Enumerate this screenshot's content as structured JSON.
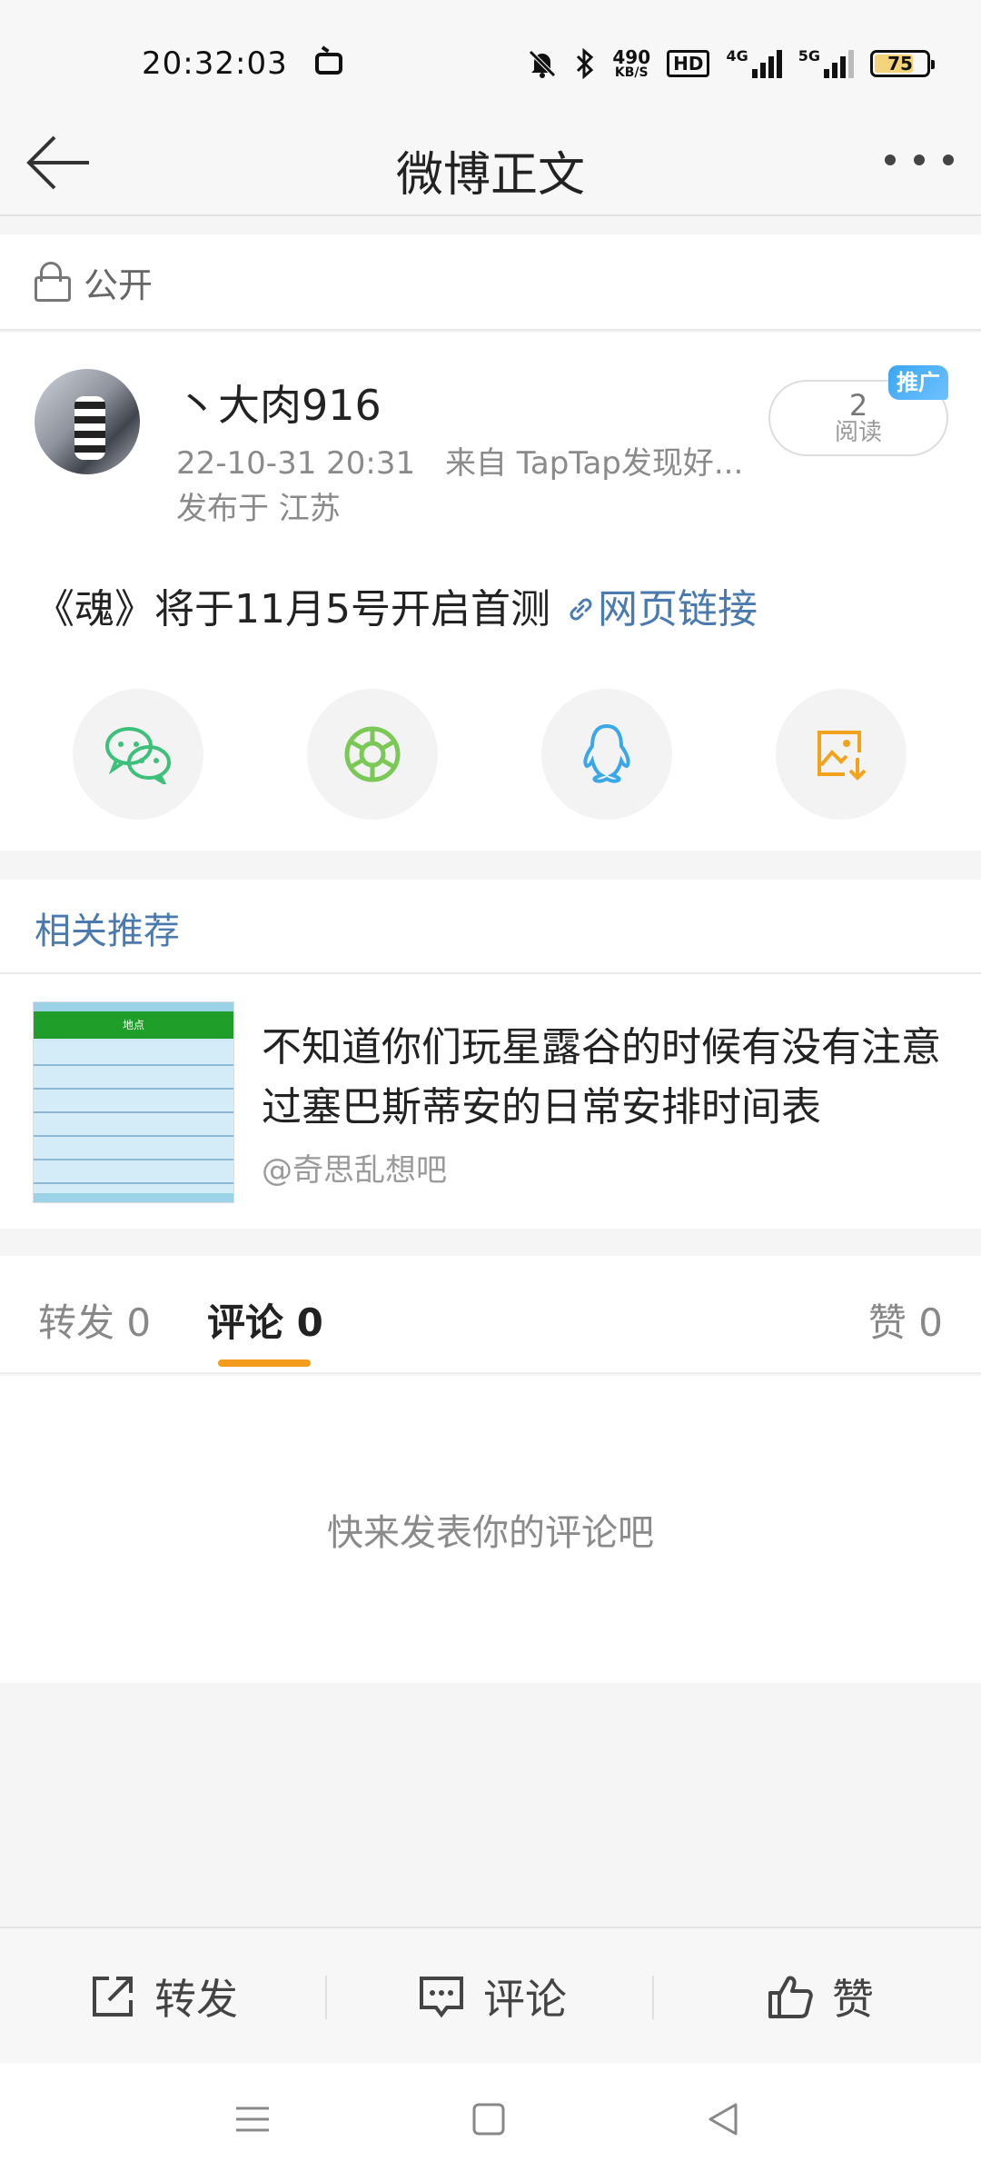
{
  "status_bar": {
    "time": "20:32:03",
    "net_speed_value": "490",
    "net_speed_unit": "KB/S",
    "hd_label": "HD",
    "net_4g": "4G",
    "net_5g": "5G",
    "battery_level": "75"
  },
  "nav": {
    "title": "微博正文"
  },
  "visibility": {
    "label": "公开"
  },
  "post": {
    "username": "丶大肉916",
    "timestamp": "22-10-31 20:31",
    "source": "来自 TapTap发现好...",
    "location": "发布于 江苏",
    "read_count": "2",
    "read_label": "阅读",
    "promo_badge": "推广",
    "text": "《魂》将于11月5号开启首测",
    "link_label": "网页链接"
  },
  "share": {
    "buttons": [
      {
        "icon": "wechat-icon"
      },
      {
        "icon": "moments-icon"
      },
      {
        "icon": "qq-icon"
      },
      {
        "icon": "save-image-icon"
      }
    ]
  },
  "related": {
    "title": "相关推荐",
    "item": {
      "text": "不知道你们玩星露谷的时候有没有注意过塞巴斯蒂安的日常安排时间表",
      "source": "@奇思乱想吧",
      "thumb_header": "地点"
    }
  },
  "tabs": {
    "repost": "转发 0",
    "comment": "评论 0",
    "like": "赞 0"
  },
  "comments": {
    "empty_text": "快来发表你的评论吧"
  },
  "actions": {
    "repost": "转发",
    "comment": "评论",
    "like": "赞"
  },
  "colors": {
    "accent_orange": "#f39b1d",
    "link_blue": "#4a7aae",
    "wechat_green": "#3cc07a",
    "moments_green": "#7ac856",
    "qq_blue": "#3aa7e8",
    "save_orange": "#f3a31b"
  }
}
